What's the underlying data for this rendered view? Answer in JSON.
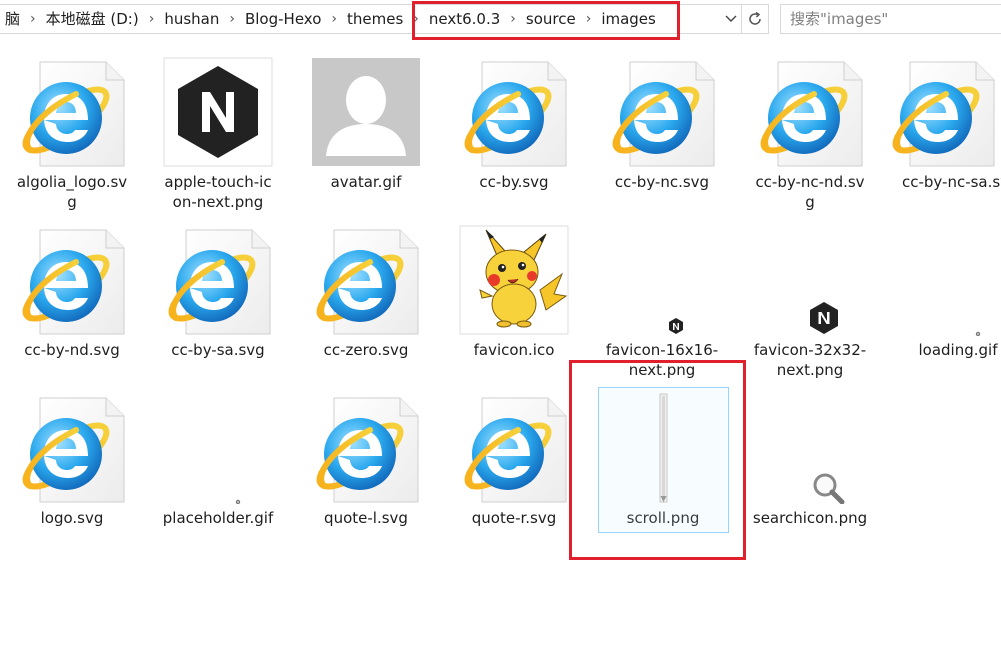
{
  "address_bar": {
    "breadcrumbs": [
      "脑",
      "本地磁盘 (D:)",
      "hushan",
      "Blog-Hexo",
      "themes",
      "next6.0.3",
      "source",
      "images"
    ],
    "dropdown_icon": "chevron-down-icon",
    "refresh_icon": "refresh-icon"
  },
  "search": {
    "placeholder": "搜索\"images\""
  },
  "highlight_color": "#e0202c",
  "files": [
    {
      "name": "algolia_logo.svg",
      "icon": "ie-svg-file-icon"
    },
    {
      "name": "apple-touch-icon-next.png",
      "icon": "next-logo-thumbnail"
    },
    {
      "name": "avatar.gif",
      "icon": "avatar-thumbnail"
    },
    {
      "name": "cc-by.svg",
      "icon": "ie-svg-file-icon"
    },
    {
      "name": "cc-by-nc.svg",
      "icon": "ie-svg-file-icon"
    },
    {
      "name": "cc-by-nc-nd.svg",
      "icon": "ie-svg-file-icon"
    },
    {
      "name": "cc-by-nc-sa.svg",
      "icon": "ie-svg-file-icon"
    },
    {
      "name": "cc-by-nd.svg",
      "icon": "ie-svg-file-icon"
    },
    {
      "name": "cc-by-sa.svg",
      "icon": "ie-svg-file-icon"
    },
    {
      "name": "cc-zero.svg",
      "icon": "ie-svg-file-icon"
    },
    {
      "name": "favicon.ico",
      "icon": "pikachu-thumbnail"
    },
    {
      "name": "favicon-16x16-next.png",
      "icon": "next-logo-small-thumbnail"
    },
    {
      "name": "favicon-32x32-next.png",
      "icon": "next-logo-medium-thumbnail"
    },
    {
      "name": "loading.gif",
      "icon": "tiny-dot-thumbnail"
    },
    {
      "name": "logo.svg",
      "icon": "ie-svg-file-icon"
    },
    {
      "name": "placeholder.gif",
      "icon": "tiny-dot-thumbnail"
    },
    {
      "name": "quote-l.svg",
      "icon": "ie-svg-file-icon"
    },
    {
      "name": "quote-r.svg",
      "icon": "ie-svg-file-icon"
    },
    {
      "name": "scroll.png",
      "icon": "scroll-bar-thumbnail",
      "selected": true
    },
    {
      "name": "searchicon.png",
      "icon": "magnifier-thumbnail"
    }
  ]
}
